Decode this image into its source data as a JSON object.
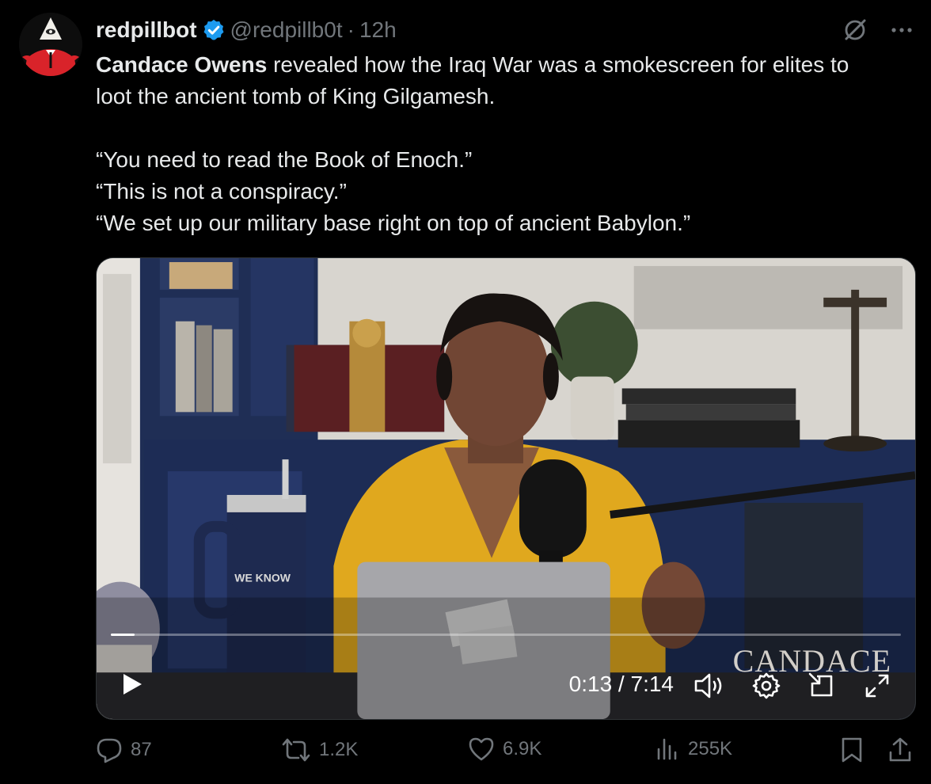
{
  "tweet": {
    "author_name": "redpillbot",
    "handle": "@redpillb0t",
    "separator": "·",
    "time": "12h",
    "text_lines": [
      {
        "bold": "Candace Owens",
        "rest": " revealed how the Iraq War was a smokescreen for elites to"
      },
      {
        "bold": "",
        "rest": "loot the ancient tomb of King Gilgamesh."
      }
    ],
    "quotes": [
      "“You need to read the Book of Enoch.”",
      "“This is not a conspiracy.”",
      "“We set up our military base right on top of ancient Babylon.”"
    ]
  },
  "video": {
    "current_time": "0:13",
    "duration": "7:14",
    "time_display": "0:13 / 7:14",
    "progress_fraction": 0.03,
    "watermark": "CANDACE",
    "cup_text": "WE KNOW",
    "icons": [
      "play-icon",
      "volume-icon",
      "settings-icon",
      "dock-icon",
      "fullscreen-icon"
    ]
  },
  "actions": {
    "replies": "87",
    "reposts": "1.2K",
    "likes": "6.9K",
    "views": "255K"
  },
  "colors": {
    "background": "#000000",
    "text": "#e7e9ea",
    "muted": "#71767b",
    "verified": "#1d9bf0",
    "avatar_red": "#d9232a"
  }
}
